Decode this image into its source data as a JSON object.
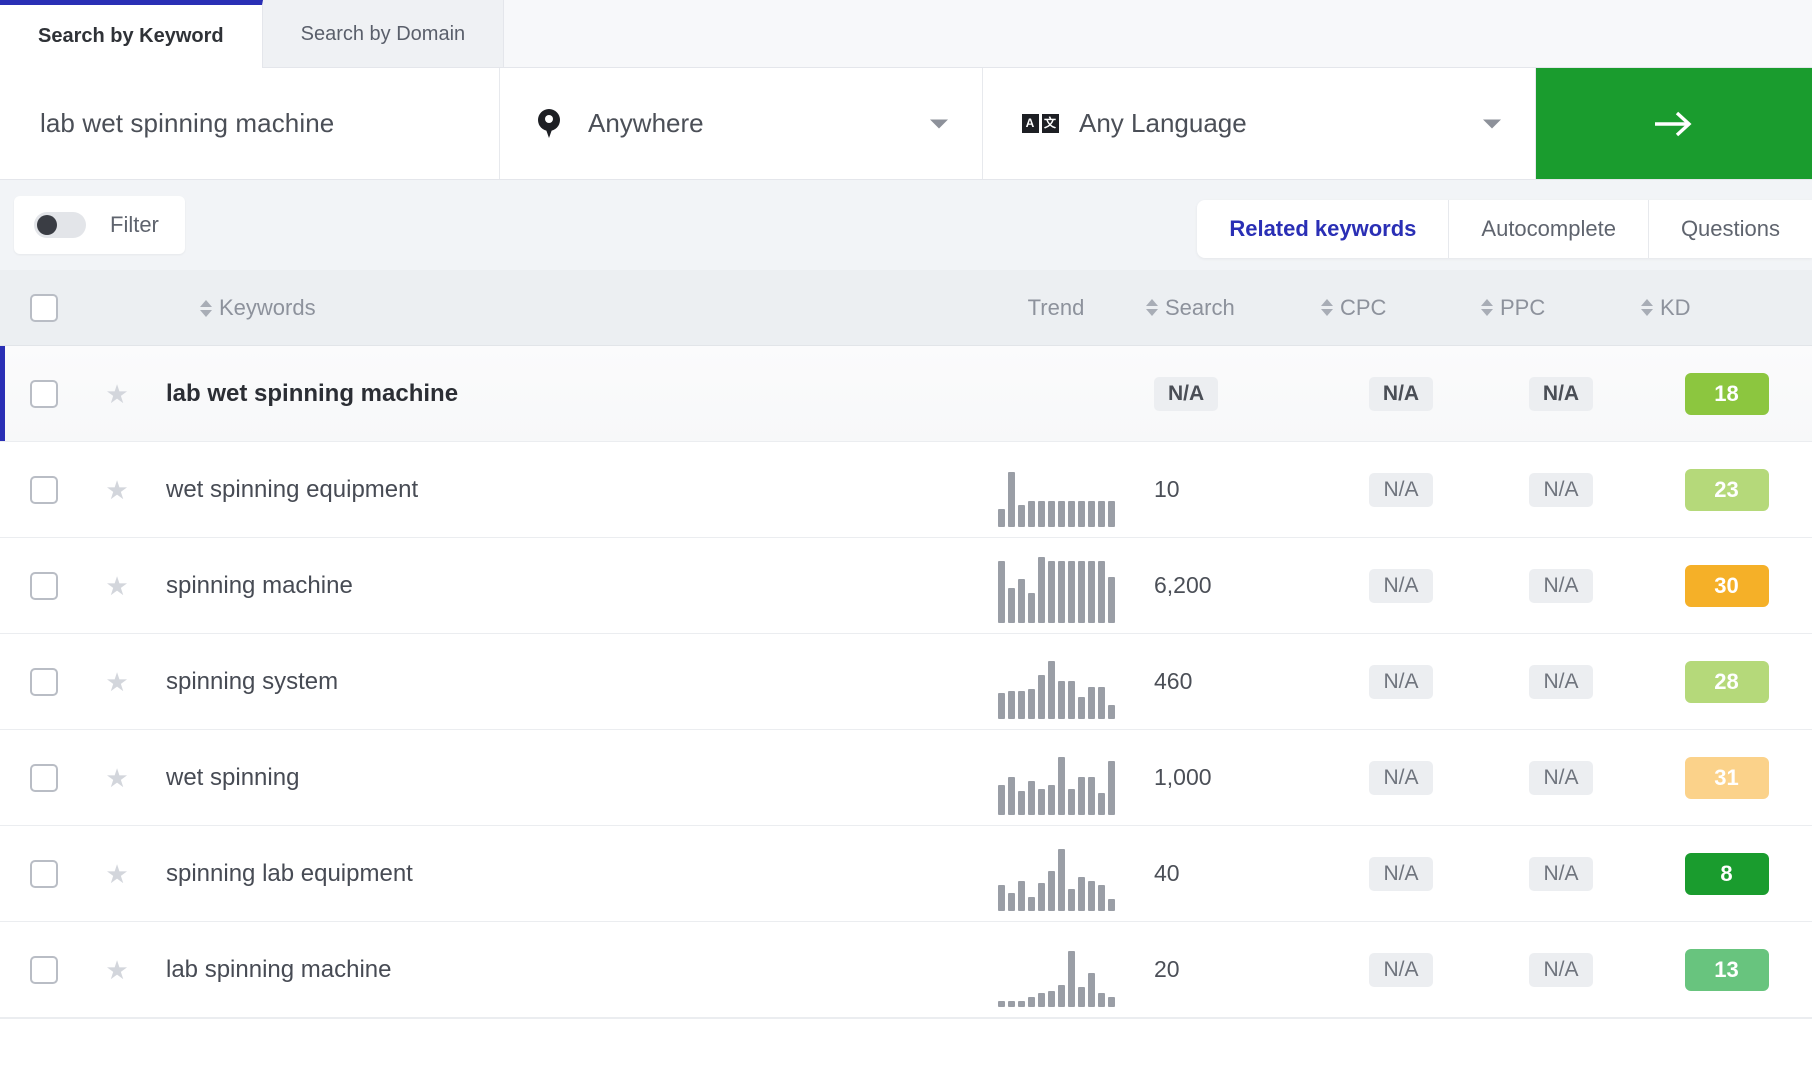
{
  "tabs": [
    {
      "label": "Search by Keyword",
      "active": true
    },
    {
      "label": "Search by Domain",
      "active": false
    }
  ],
  "search": {
    "keyword_value": "lab wet spinning machine",
    "location_value": "Anywhere",
    "location_icon": "location-pin-icon",
    "language_value": "Any Language",
    "language_icon": "translate-icon",
    "submit_icon": "arrow-right-icon",
    "submit_color": "#1a9c2e"
  },
  "filter": {
    "label": "Filter",
    "enabled": false
  },
  "view_tabs": [
    {
      "label": "Related keywords",
      "active": true
    },
    {
      "label": "Autocomplete",
      "active": false
    },
    {
      "label": "Questions",
      "active": false
    }
  ],
  "table": {
    "columns": [
      {
        "key": "checkbox",
        "label": "",
        "sortable": false
      },
      {
        "key": "star",
        "label": "",
        "sortable": false
      },
      {
        "key": "keywords",
        "label": "Keywords",
        "sortable": true
      },
      {
        "key": "trend",
        "label": "Trend",
        "sortable": false
      },
      {
        "key": "search",
        "label": "Search",
        "sortable": true
      },
      {
        "key": "cpc",
        "label": "CPC",
        "sortable": true
      },
      {
        "key": "ppc",
        "label": "PPC",
        "sortable": true
      },
      {
        "key": "kd",
        "label": "KD",
        "sortable": true
      }
    ],
    "rows": [
      {
        "keyword": "lab wet spinning machine",
        "selected": true,
        "starred": false,
        "trend": [],
        "search": "N/A",
        "search_is_na": true,
        "cpc": "N/A",
        "ppc": "N/A",
        "kd": "18",
        "kd_color": "#8cc63f"
      },
      {
        "keyword": "wet spinning equipment",
        "selected": false,
        "starred": false,
        "trend": [
          18,
          55,
          22,
          26,
          26,
          26,
          26,
          26,
          26,
          26,
          26,
          26
        ],
        "search": "10",
        "search_is_na": false,
        "cpc": "N/A",
        "ppc": "N/A",
        "kd": "23",
        "kd_color": "#b5d97a"
      },
      {
        "keyword": "spinning machine",
        "selected": false,
        "starred": false,
        "trend": [
          62,
          35,
          44,
          30,
          66,
          62,
          62,
          62,
          62,
          62,
          62,
          46
        ],
        "search": "6,200",
        "search_is_na": false,
        "cpc": "N/A",
        "ppc": "N/A",
        "kd": "30",
        "kd_color": "#f5b028"
      },
      {
        "keyword": "spinning system",
        "selected": false,
        "starred": false,
        "trend": [
          26,
          28,
          28,
          30,
          44,
          58,
          38,
          38,
          22,
          32,
          32,
          14
        ],
        "search": "460",
        "search_is_na": false,
        "cpc": "N/A",
        "ppc": "N/A",
        "kd": "28",
        "kd_color": "#b5d97a"
      },
      {
        "keyword": "wet spinning",
        "selected": false,
        "starred": false,
        "trend": [
          30,
          38,
          24,
          34,
          26,
          30,
          58,
          26,
          38,
          38,
          22,
          54
        ],
        "search": "1,000",
        "search_is_na": false,
        "cpc": "N/A",
        "ppc": "N/A",
        "kd": "31",
        "kd_color": "#fbd28a"
      },
      {
        "keyword": "spinning lab equipment",
        "selected": false,
        "starred": false,
        "trend": [
          26,
          18,
          30,
          14,
          28,
          40,
          62,
          22,
          34,
          30,
          26,
          12
        ],
        "search": "40",
        "search_is_na": false,
        "cpc": "N/A",
        "ppc": "N/A",
        "kd": "8",
        "kd_color": "#1a9c2e"
      },
      {
        "keyword": "lab spinning machine",
        "selected": false,
        "starred": false,
        "trend": [
          6,
          6,
          6,
          10,
          14,
          16,
          22,
          56,
          20,
          34,
          14,
          10
        ],
        "search": "20",
        "search_is_na": false,
        "cpc": "N/A",
        "ppc": "N/A",
        "kd": "13",
        "kd_color": "#68c47e"
      }
    ]
  },
  "colors": {
    "accent_blue": "#2a2fb5",
    "accent_green": "#1a9c2e",
    "header_bg": "#eceff2",
    "filter_bg": "#f2f4f7"
  }
}
